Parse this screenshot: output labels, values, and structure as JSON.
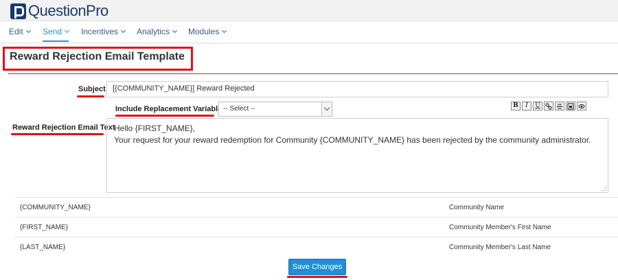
{
  "app": {
    "logo_text": "QuestionPro",
    "brand_color": "#1b3a6b",
    "accent_color": "#2d8ed6",
    "highlight_color": "#e0101a"
  },
  "menu": {
    "items": [
      {
        "label": "Edit",
        "active": false
      },
      {
        "label": "Send",
        "active": true
      },
      {
        "label": "Incentives",
        "active": false
      },
      {
        "label": "Analytics",
        "active": false
      },
      {
        "label": "Modules",
        "active": false
      }
    ]
  },
  "page": {
    "title": "Reward Rejection Email Template"
  },
  "form": {
    "subject_label": "Subject",
    "subject_value": "[{COMMUNITY_NAME}] Reward Rejected",
    "variables_label": "Include Replacement Variables:",
    "variables_selected": "-- Select --",
    "body_label": "Reward Rejection Email Text",
    "body_line1": "Hello {FIRST_NAME},",
    "body_line2": "Your request for your reward redemption for Community {COMMUNITY_NAME} has been rejected by the community administrator."
  },
  "toolbar": {
    "bold": "B",
    "italic": "I",
    "underline": "U",
    "icons": [
      "link-icon",
      "strikethrough-icon",
      "image-icon",
      "preview-eye-icon"
    ]
  },
  "variables": [
    {
      "name": "{COMMUNITY_NAME}",
      "description": "Community Name"
    },
    {
      "name": "{FIRST_NAME}",
      "description": "Community Member's First Name"
    },
    {
      "name": "{LAST_NAME}",
      "description": "Community Member's Last Name"
    }
  ],
  "actions": {
    "save_label": "Save Changes"
  }
}
